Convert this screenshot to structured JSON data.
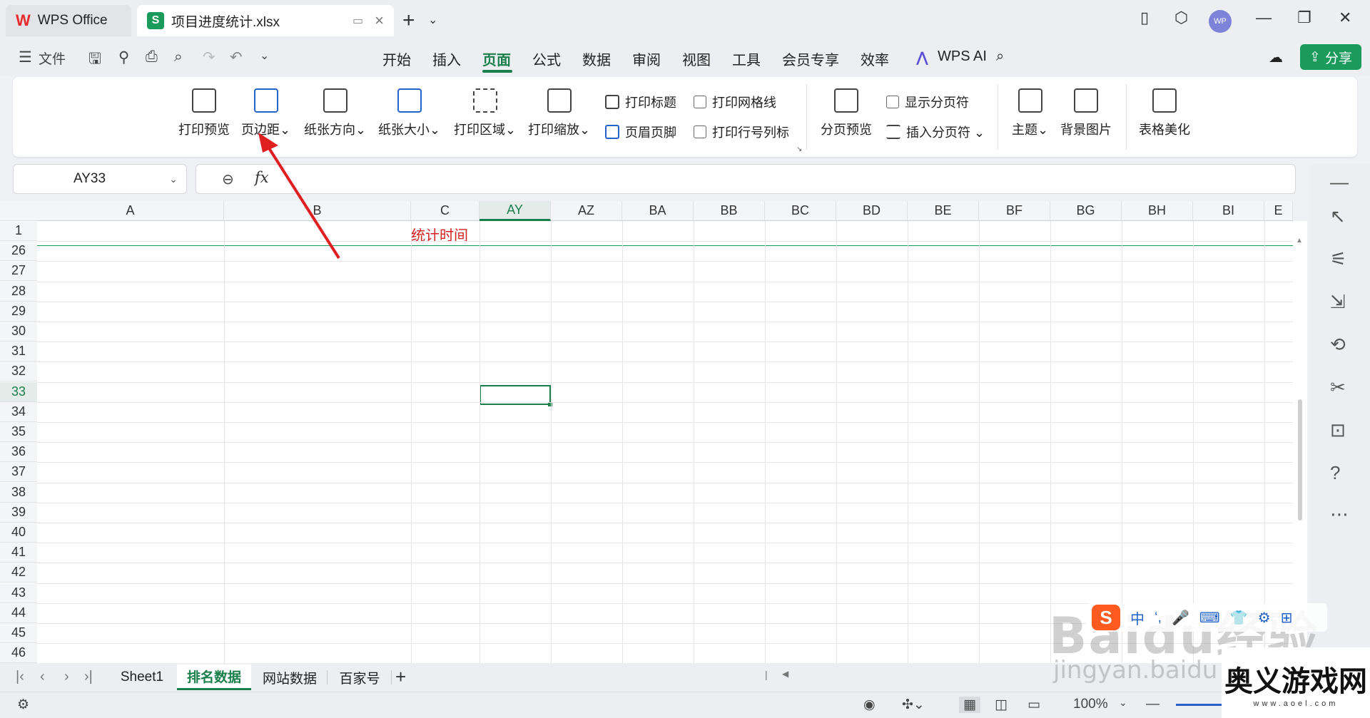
{
  "tabs": {
    "home": "WPS Office",
    "file": "项目进度统计.xlsx"
  },
  "avatar": "WP",
  "menu": {
    "file": "文件",
    "items": [
      "开始",
      "插入",
      "页面",
      "公式",
      "数据",
      "审阅",
      "视图",
      "工具",
      "会员专享",
      "效率"
    ],
    "active": "页面",
    "ai": "WPS AI",
    "share": "分享"
  },
  "ribbon": {
    "print_preview": "打印预览",
    "margins": "页边距",
    "orientation": "纸张方向",
    "paper_size": "纸张大小",
    "print_area": "打印区域",
    "print_scale": "打印缩放",
    "print_titles": "打印标题",
    "header_footer": "页眉页脚",
    "print_gridlines": "打印网格线",
    "print_row_col_headers": "打印行号列标",
    "page_break_preview": "分页预览",
    "show_page_breaks": "显示分页符",
    "insert_page_break": "插入分页符",
    "theme": "主题",
    "background_image": "背景图片",
    "table_beautify": "表格美化"
  },
  "formula": {
    "name_box": "AY33",
    "fx": "fx"
  },
  "grid": {
    "columns": [
      "A",
      "B",
      "C",
      "AY",
      "AZ",
      "BA",
      "BB",
      "BC",
      "BD",
      "BE",
      "BF",
      "BG",
      "BH",
      "BI",
      "E"
    ],
    "selected_column": "AY",
    "rows": [
      "1",
      "26",
      "27",
      "28",
      "29",
      "30",
      "31",
      "32",
      "33",
      "34",
      "35",
      "36",
      "37",
      "38",
      "39",
      "40",
      "41",
      "42",
      "43",
      "44",
      "45",
      "46"
    ],
    "selected_row": "33",
    "cell_c1": "统计时间"
  },
  "sheets": [
    "Sheet1",
    "排名数据",
    "网站数据",
    "百家号"
  ],
  "active_sheet": "排名数据",
  "status": {
    "zoom": "100%"
  },
  "watermark": {
    "baidu": "Baidu经验",
    "jingyan": "jingyan.baidu",
    "ime": "中",
    "site_name": "奥义游戏网",
    "site_url": "www.aoel.com"
  },
  "colors": {
    "accent": "#1a7f4b",
    "red_text": "#d42222",
    "arrow": "#e02020"
  }
}
